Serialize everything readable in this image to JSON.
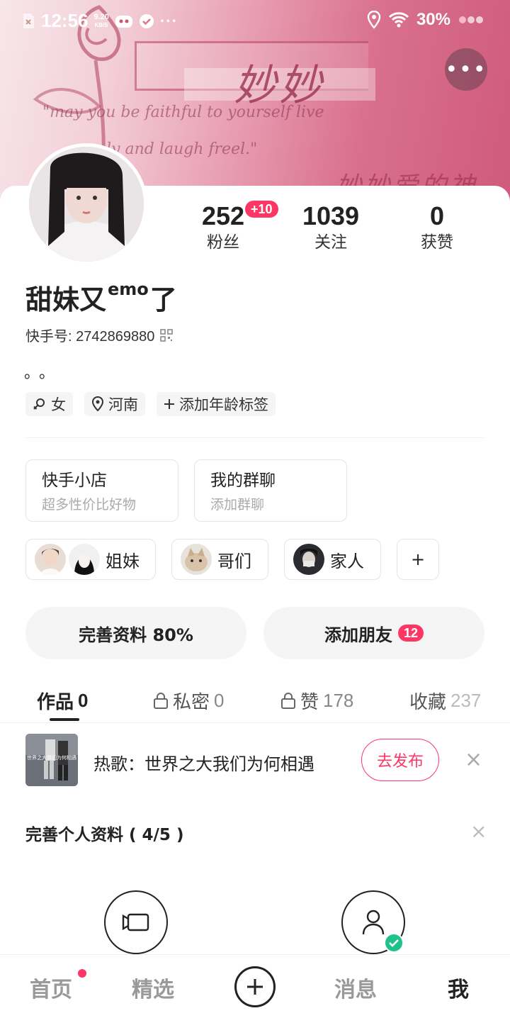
{
  "status_bar": {
    "time": "12:56",
    "net_speed_value": "9.20",
    "net_speed_unit": "KB/S",
    "battery": "30%"
  },
  "banner": {
    "title_art": "妙妙",
    "quote_line1": "\"may you be faithful to yourself live",
    "quote_line2": "ly and laugh freel.\"",
    "subtitle_art": "妙妙爱的神"
  },
  "profile": {
    "name_part1": "甜妹又",
    "name_sup": "emo",
    "name_part2": "了",
    "kuaishou_id_label": "快手号: ",
    "kuaishou_id": "2742869880",
    "bio": "。。",
    "stats": [
      {
        "value": "252",
        "label": "粉丝",
        "badge": "+10"
      },
      {
        "value": "1039",
        "label": "关注"
      },
      {
        "value": "0",
        "label": "获赞"
      }
    ],
    "tags": [
      {
        "icon": "female-icon",
        "label": "女"
      },
      {
        "icon": "location-pin-icon",
        "label": "河南"
      },
      {
        "icon": "plus-icon",
        "label": "添加年龄标签"
      }
    ]
  },
  "features": [
    {
      "title": "快手小店",
      "subtitle": "超多性价比好物"
    },
    {
      "title": "我的群聊",
      "subtitle": "添加群聊"
    }
  ],
  "groups": [
    {
      "label": "姐妹"
    },
    {
      "label": "哥们"
    },
    {
      "label": "家人"
    },
    {
      "label": "+"
    }
  ],
  "actions": {
    "complete_profile": "完善资料 80%",
    "add_friends": "添加朋友",
    "add_friends_badge": "12"
  },
  "tabs": [
    {
      "label": "作品",
      "count": "0",
      "active": true
    },
    {
      "label": "私密",
      "count": "0",
      "locked": true
    },
    {
      "label": "赞",
      "count": "178",
      "locked": true
    },
    {
      "label": "收藏",
      "count": "237"
    }
  ],
  "music_banner": {
    "text": "热歌：世界之大我们为何相遇",
    "button": "去发布",
    "close": "×",
    "thumb_caption": "世界之大我们为何相遇"
  },
  "complete_section": {
    "title": "完善个人资料 ( 4/5 )",
    "close": "×"
  },
  "bottom_nav": [
    {
      "label": "首页",
      "dot": true
    },
    {
      "label": "精选"
    },
    {
      "label": "+"
    },
    {
      "label": "消息"
    },
    {
      "label": "我",
      "active": true
    }
  ],
  "colors": {
    "accent": "#fe3666",
    "text": "#222222",
    "muted": "#999999",
    "verified": "#1fc28b"
  }
}
